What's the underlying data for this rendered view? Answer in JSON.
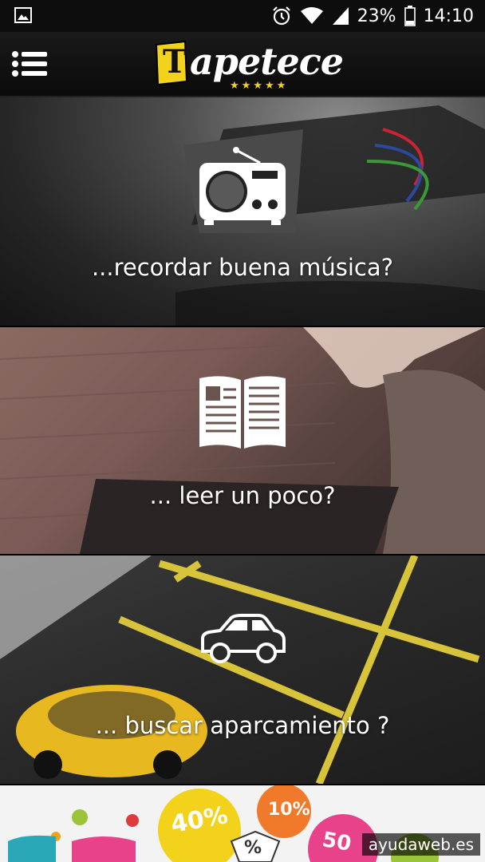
{
  "status_bar": {
    "battery": "23%",
    "time": "14:10",
    "icons": [
      "image-notification-icon",
      "alarm-icon",
      "wifi-icon",
      "signal-icon",
      "battery-icon"
    ]
  },
  "app_bar": {
    "logo_text": "apetece",
    "logo_letter": "T",
    "logo_stars": "★★★★★",
    "menu_icon": "hamburger-menu-icon"
  },
  "panels": [
    {
      "label": "...recordar buena música?",
      "icon": "radio-icon"
    },
    {
      "label": "... leer un poco?",
      "icon": "book-icon"
    },
    {
      "label": "... buscar aparcamiento ?",
      "icon": "car-icon"
    }
  ],
  "ad": {
    "badges": [
      "40%",
      "10%",
      "50",
      "%"
    ]
  },
  "watermark": "ayudaweb.es",
  "colors": {
    "accent": "#f2d21a",
    "status_bar": "#0d0d0d",
    "app_bar": "#111111"
  }
}
